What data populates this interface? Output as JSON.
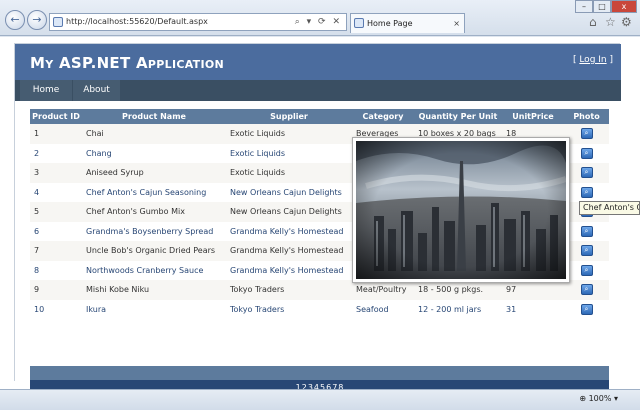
{
  "browser": {
    "address": "http://localhost:55620/Default.aspx",
    "address_tools": "⌕ ▾ ⟳ ✕",
    "tab_title": "Home Page",
    "tab_close": "×",
    "back_glyph": "←",
    "forward_glyph": "→",
    "win_min": "–",
    "win_max": "□",
    "win_close": "x",
    "home_glyph": "⌂",
    "star_glyph": "☆",
    "gear_glyph": "⚙",
    "zoom_label": "100%"
  },
  "app": {
    "title": "My ASP.NET Application",
    "login_open": "[ ",
    "login_link": "Log In",
    "login_close": " ]"
  },
  "menu": [
    {
      "label": "Home"
    },
    {
      "label": "About"
    }
  ],
  "table": {
    "headers": [
      "Product ID",
      "Product Name",
      "Supplier",
      "Category",
      "Quantity Per Unit",
      "UnitPrice",
      "Photo"
    ],
    "rows": [
      {
        "id": "1",
        "name": "Chai",
        "supplier": "Exotic Liquids",
        "category": "Beverages",
        "qty": "10 boxes x 20 bags",
        "price": "18"
      },
      {
        "id": "2",
        "name": "Chang",
        "supplier": "Exotic Liquids",
        "category": "",
        "qty": "",
        "price": ""
      },
      {
        "id": "3",
        "name": "Aniseed Syrup",
        "supplier": "Exotic Liquids",
        "category": "",
        "qty": "",
        "price": ""
      },
      {
        "id": "4",
        "name": "Chef Anton's Cajun Seasoning",
        "supplier": "New Orleans Cajun Delights",
        "category": "",
        "qty": "",
        "price": ""
      },
      {
        "id": "5",
        "name": "Chef Anton's Gumbo Mix",
        "supplier": "New Orleans Cajun Delights",
        "category": "",
        "qty": "",
        "price": ""
      },
      {
        "id": "6",
        "name": "Grandma's Boysenberry Spread",
        "supplier": "Grandma Kelly's Homestead",
        "category": "",
        "qty": "",
        "price": ""
      },
      {
        "id": "7",
        "name": "Uncle Bob's Organic Dried Pears",
        "supplier": "Grandma Kelly's Homestead",
        "category": "",
        "qty": "",
        "price": ""
      },
      {
        "id": "8",
        "name": "Northwoods Cranberry Sauce",
        "supplier": "Grandma Kelly's Homestead",
        "category": "",
        "qty": "",
        "price": ""
      },
      {
        "id": "9",
        "name": "Mishi Kobe Niku",
        "supplier": "Tokyo Traders",
        "category": "Meat/Poultry",
        "qty": "18 - 500 g pkgs.",
        "price": "97"
      },
      {
        "id": "10",
        "name": "Ikura",
        "supplier": "Tokyo Traders",
        "category": "Seafood",
        "qty": "12 - 200 ml jars",
        "price": "31"
      }
    ],
    "photo_icon": "search-icon"
  },
  "pager": {
    "pages": [
      "1",
      "2",
      "3",
      "4",
      "5",
      "6",
      "7",
      "8"
    ],
    "current": "1"
  },
  "tooltip": "Chef Anton's Cajun Seasoning"
}
